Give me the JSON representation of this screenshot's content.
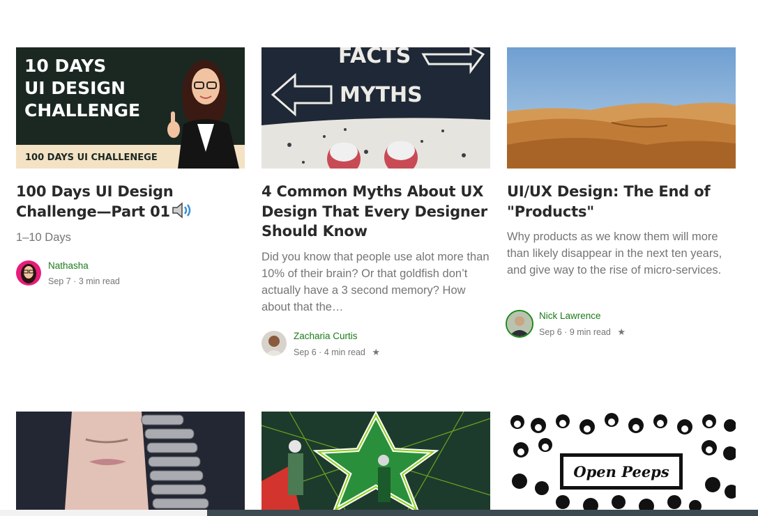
{
  "articles": [
    {
      "image_text": {
        "line1": "10 DAYS",
        "line2": "UI DESIGN",
        "line3": "CHALLENGE",
        "band": "100 DAYS UI CHALLENEGE"
      },
      "title": "100 Days UI Design Challenge—Part 01",
      "subtitle": "1–10 Days",
      "author": "Nathasha",
      "date": "Sep 7",
      "read_time": "3 min read",
      "starred": false
    },
    {
      "image_text": {
        "facts": "FACTS",
        "myths": "MYTHS"
      },
      "title": "4 Common Myths About UX Design That Every Designer Should Know",
      "subtitle": "Did you know that people use alot more than 10% of their brain? Or that goldfish don’t actually have a 3 second memory? How about that the…",
      "author": "Zacharia Curtis",
      "date": "Sep 6",
      "read_time": "4 min read",
      "starred": true
    },
    {
      "title": "UI/UX Design: The End of \"Products\"",
      "subtitle": "Why products as we know them will more than likely disappear in the next ten years, and give way to the rise of micro-services.",
      "author": "Nick Lawrence",
      "date": "Sep 6",
      "read_time": "9 min read",
      "starred": true
    },
    {},
    {},
    {
      "image_text": {
        "label": "Open Peeps"
      }
    }
  ],
  "separator": "·",
  "icons": {
    "speaker": "speaker-icon",
    "star": "star-icon"
  },
  "colors": {
    "author": "#1a7b1a",
    "meta": "#757575",
    "title": "#292929"
  }
}
